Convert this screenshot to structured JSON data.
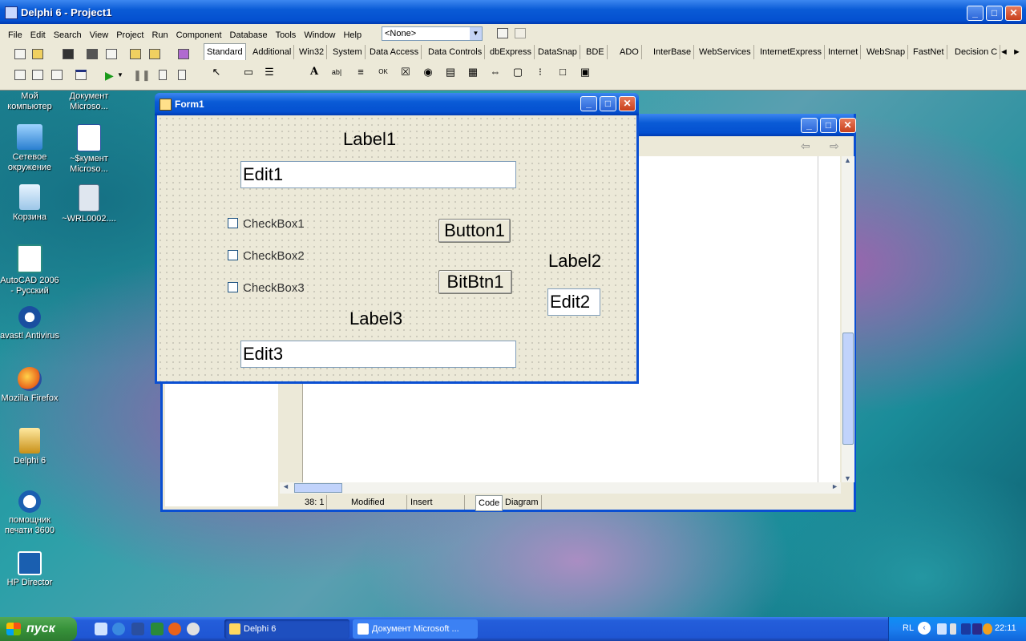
{
  "ide": {
    "title": "Delphi 6 - Project1",
    "menu": [
      "File",
      "Edit",
      "Search",
      "View",
      "Project",
      "Run",
      "Component",
      "Database",
      "Tools",
      "Window",
      "Help"
    ],
    "combo_value": "<None>",
    "palette_tabs": [
      "Standard",
      "Additional",
      "Win32",
      "System",
      "Data Access",
      "Data Controls",
      "dbExpress",
      "DataSnap",
      "BDE",
      "ADO",
      "InterBase",
      "WebServices",
      "InternetExpress",
      "Internet",
      "WebSnap",
      "FastNet",
      "Decision C"
    ],
    "active_tab": "Standard"
  },
  "desktop_icons": [
    {
      "label": "Мой компьютер"
    },
    {
      "label": "Документ Microso..."
    },
    {
      "label": "Сетевое окружение"
    },
    {
      "label": "~$кумент Microso..."
    },
    {
      "label": "Корзина"
    },
    {
      "label": "~WRL0002...."
    },
    {
      "label": "AutoCAD 2006 - Русский"
    },
    {
      "label": "avast! Antivirus"
    },
    {
      "label": "Mozilla Firefox"
    },
    {
      "label": "Delphi 6"
    },
    {
      "label": "помощник печати 3600"
    },
    {
      "label": "HP Director"
    }
  ],
  "form": {
    "title": "Form1",
    "label1": "Label1",
    "edit1": "Edit1",
    "checkbox1": "CheckBox1",
    "checkbox2": "CheckBox2",
    "checkbox3": "CheckBox3",
    "button1": "Button1",
    "bitbtn1": "BitBtn1",
    "label2": "Label2",
    "edit2": "Edit2",
    "label3": "Label3",
    "edit3": "Edit3"
  },
  "editor": {
    "status_position": "38:   1",
    "status_modified": "Modified",
    "status_mode": "Insert",
    "tab_code": "Code",
    "tab_diagram": "Diagram"
  },
  "taskbar": {
    "start_label": "пуск",
    "tasks": [
      {
        "label": "Delphi 6"
      },
      {
        "label": "Документ Microsoft ..."
      }
    ],
    "lang": "RL",
    "clock": "22:11"
  }
}
